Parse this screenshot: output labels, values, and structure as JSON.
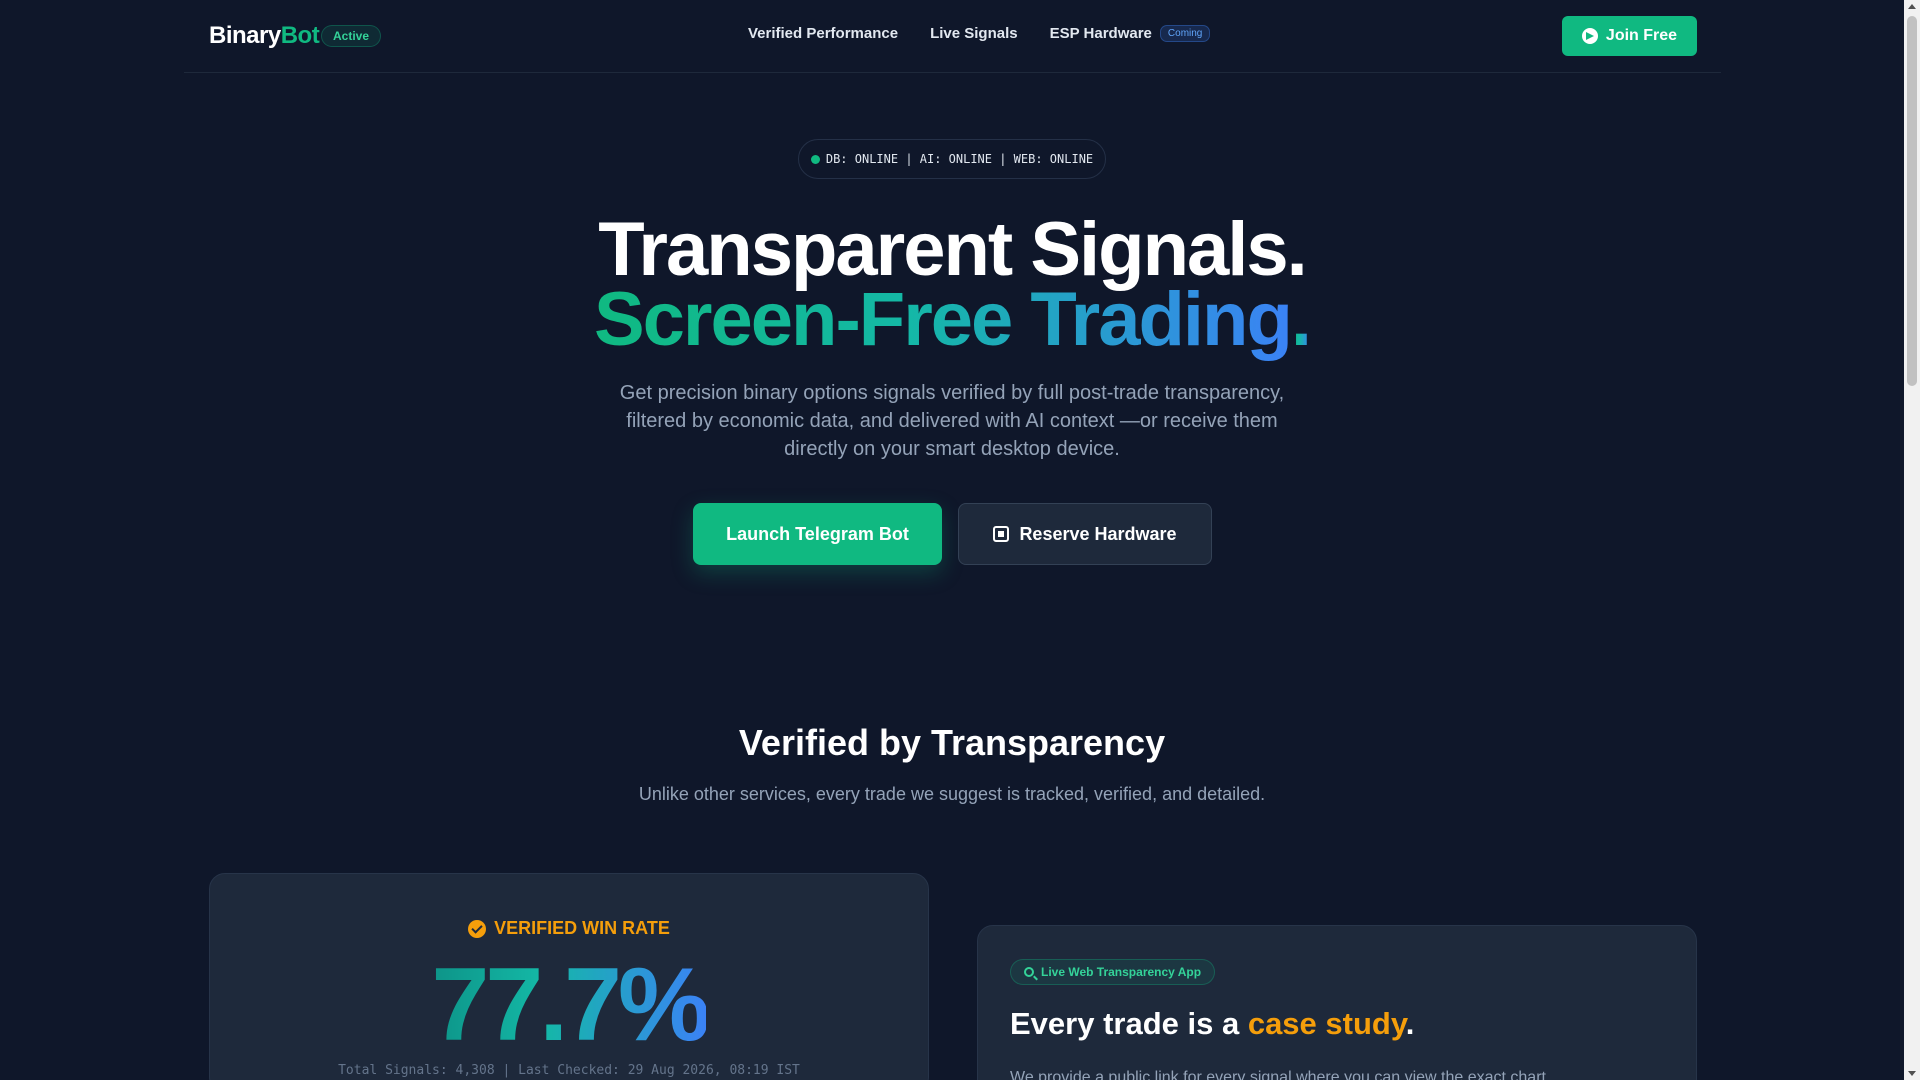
{
  "nav": {
    "logo_primary": "Binary",
    "logo_accent": "Bot",
    "status_badge": "Active",
    "links": [
      {
        "label": "Verified Performance"
      },
      {
        "label": "Live Signals"
      },
      {
        "label": "ESP Hardware",
        "badge": "Coming"
      }
    ],
    "join_button": "Join Free"
  },
  "hero": {
    "system_status": "DB: ONLINE | AI: ONLINE | WEB: ONLINE",
    "headline_line1": "Transparent Signals.",
    "headline_line2_a": "Screen-Free Trading",
    "headline_line2_b": ".",
    "subtitle": "Get precision binary options signals verified by full post-trade transparency, filtered by economic data, and delivered with AI context —or receive them directly on your smart desktop device.",
    "primary_button": "Launch Telegram Bot",
    "secondary_button": "Reserve Hardware"
  },
  "transparency": {
    "title": "Verified by Transparency",
    "subtitle": "Unlike other services, every trade we suggest is tracked, verified, and detailed.",
    "win_rate": {
      "label": "VERIFIED WIN RATE",
      "value": "77.7%",
      "meta": "Total Signals: 4,308  | Last Checked: 29 Aug 2026, 08:19 IST"
    },
    "case_study": {
      "pill": "Live Web Transparency App",
      "title_prefix": "Every trade is a ",
      "title_highlight": "case study",
      "title_suffix": ".",
      "description": "We provide a public link for every signal where you can view the exact chart"
    }
  },
  "colors": {
    "background": "#0f172a",
    "card": "#1e293b",
    "accent_green": "#10b981",
    "accent_blue": "#3b82f6",
    "accent_amber": "#f59e0b"
  },
  "icons": {
    "join_button": "telegram-icon",
    "reserve_button": "chip-icon",
    "win_rate": "check-circle-icon",
    "case_study_pill": "search-icon",
    "status": "status-dot"
  }
}
